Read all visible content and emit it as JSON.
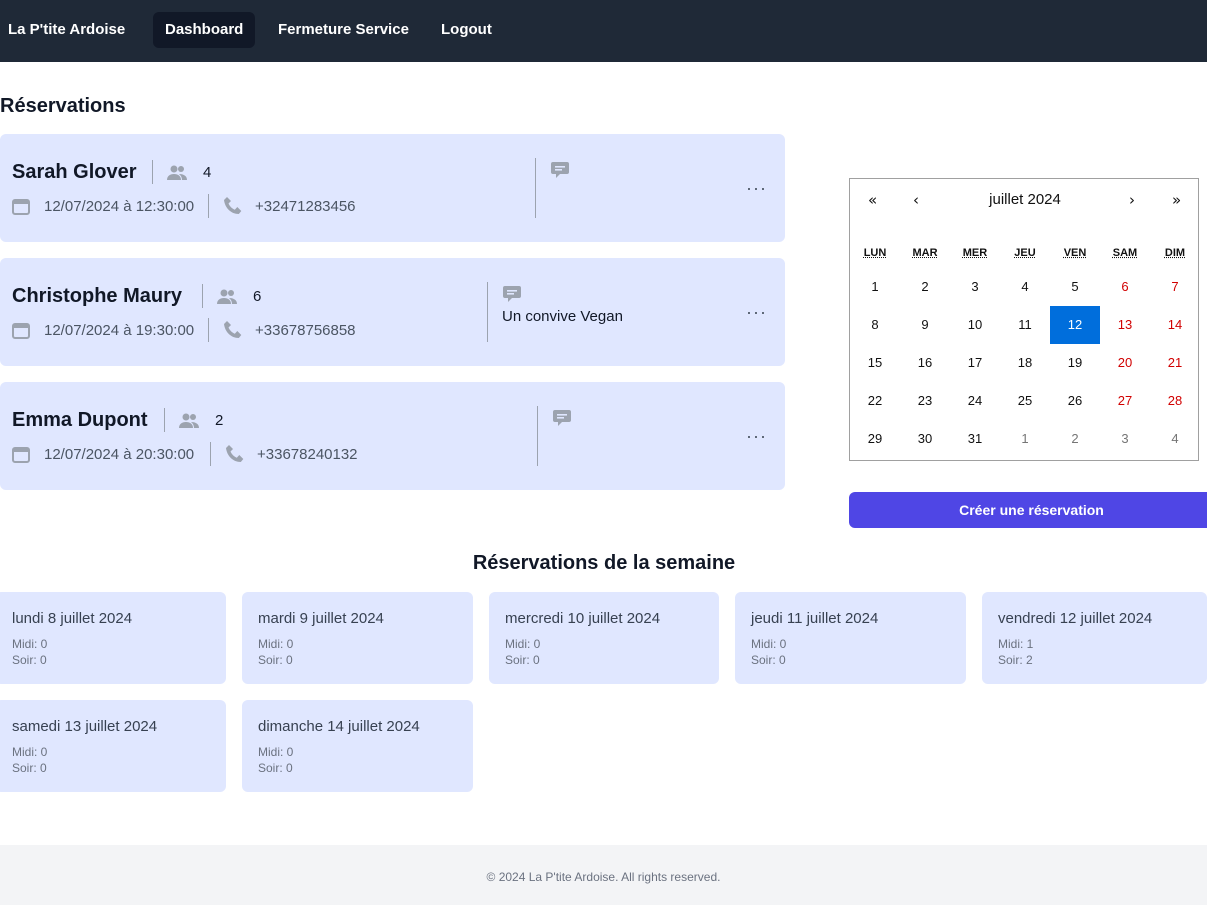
{
  "nav": {
    "brand": "La P'tite Ardoise",
    "items": [
      {
        "label": "Dashboard"
      },
      {
        "label": "Fermeture Service"
      },
      {
        "label": "Logout"
      }
    ]
  },
  "reservations": {
    "title": "Réservations",
    "items": [
      {
        "name": "Sarah Glover",
        "guests": "4",
        "datetime": "12/07/2024 à 12:30:00",
        "phone": "+32471283456",
        "comment": ""
      },
      {
        "name": "Christophe Maury",
        "guests": "6",
        "datetime": "12/07/2024 à 19:30:00",
        "phone": "+33678756858",
        "comment": "Un convive Vegan"
      },
      {
        "name": "Emma Dupont",
        "guests": "2",
        "datetime": "12/07/2024 à 20:30:00",
        "phone": "+33678240132",
        "comment": ""
      }
    ],
    "more_label": "···"
  },
  "calendar": {
    "prev_year": "«",
    "prev_month": "‹",
    "month_label": "juillet 2024",
    "next_month": "›",
    "next_year": "»",
    "weekdays": [
      "LUN",
      "MAR",
      "MER",
      "JEU",
      "VEN",
      "SAM",
      "DIM"
    ],
    "weeks": [
      [
        "1",
        "2",
        "3",
        "4",
        "5",
        "6",
        "7"
      ],
      [
        "8",
        "9",
        "10",
        "11",
        "12",
        "13",
        "14"
      ],
      [
        "15",
        "16",
        "17",
        "18",
        "19",
        "20",
        "21"
      ],
      [
        "22",
        "23",
        "24",
        "25",
        "26",
        "27",
        "28"
      ],
      [
        "29",
        "30",
        "31",
        "1",
        "2",
        "3",
        "4"
      ]
    ],
    "selected": "12"
  },
  "create_button": "Créer une réservation",
  "week": {
    "title": "Réservations de la semaine",
    "days": [
      {
        "label": "lundi 8 juillet 2024",
        "midi": "Midi: 0",
        "soir": "Soir: 0"
      },
      {
        "label": "mardi 9 juillet 2024",
        "midi": "Midi: 0",
        "soir": "Soir: 0"
      },
      {
        "label": "mercredi 10 juillet 2024",
        "midi": "Midi: 0",
        "soir": "Soir: 0"
      },
      {
        "label": "jeudi 11 juillet 2024",
        "midi": "Midi: 0",
        "soir": "Soir: 0"
      },
      {
        "label": "vendredi 12 juillet 2024",
        "midi": "Midi: 1",
        "soir": "Soir: 2"
      },
      {
        "label": "samedi 13 juillet 2024",
        "midi": "Midi: 0",
        "soir": "Soir: 0"
      },
      {
        "label": "dimanche 14 juillet 2024",
        "midi": "Midi: 0",
        "soir": "Soir: 0"
      }
    ]
  },
  "footer": "© 2024 La P'tite Ardoise. All rights reserved.",
  "colors": {
    "nav_bg": "#1f2937",
    "card_bg": "#e0e7ff",
    "accent": "#4f46e5",
    "calendar_selected": "#006edc",
    "weekend": "#d10000"
  }
}
